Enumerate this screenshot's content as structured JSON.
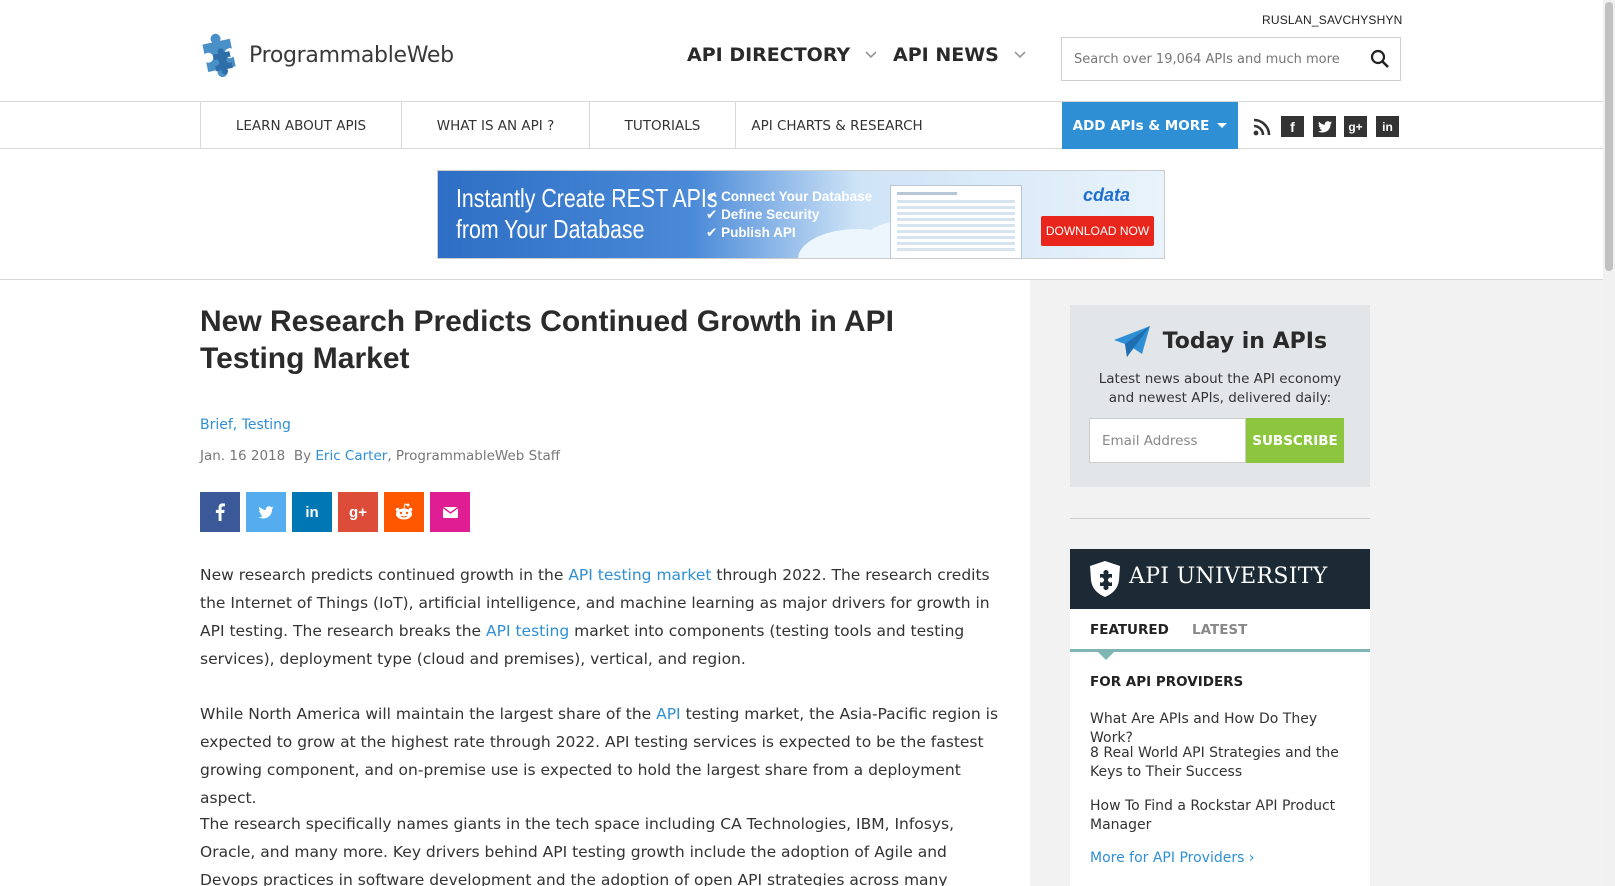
{
  "header": {
    "logo_text": "ProgrammableWeb",
    "username": "RUSLAN_SAVCHYSHYN",
    "nav": [
      {
        "label": "API DIRECTORY"
      },
      {
        "label": "API NEWS"
      }
    ],
    "search": {
      "placeholder": "Search over 19,064 APIs and much more"
    }
  },
  "subnav": {
    "items": [
      {
        "label": "LEARN ABOUT APIS"
      },
      {
        "label": "WHAT IS AN API ?"
      },
      {
        "label": "TUTORIALS"
      },
      {
        "label": "API CHARTS & RESEARCH"
      }
    ],
    "add_label": "ADD APIs & MORE",
    "social_icons": [
      "rss-icon",
      "facebook-icon",
      "twitter-icon",
      "google-plus-icon",
      "linkedin-icon"
    ]
  },
  "banner": {
    "headline_1": "Instantly Create REST APIs",
    "headline_2": "from Your Database",
    "bullets": [
      "Connect Your Database",
      "Define Security",
      "Publish API"
    ],
    "brand": "cdata",
    "cta": "DOWNLOAD NOW"
  },
  "article": {
    "title": "New Research Predicts Continued Growth in API Testing Market",
    "categories": [
      {
        "label": "Brief"
      },
      {
        "label": "Testing"
      }
    ],
    "date": "Jan. 16 2018",
    "by": "By",
    "author": "Eric Carter",
    "author_role": ", ProgrammableWeb Staff",
    "share_buttons": [
      {
        "icon": "facebook-icon",
        "color": "#3b5998"
      },
      {
        "icon": "twitter-icon",
        "color": "#55acee"
      },
      {
        "icon": "linkedin-icon",
        "color": "#0077b5"
      },
      {
        "icon": "google-plus-icon",
        "color": "#dd4b39"
      },
      {
        "icon": "reddit-icon",
        "color": "#ff5700"
      },
      {
        "icon": "email-icon",
        "color": "#e01e94"
      }
    ],
    "p1": {
      "a": "New research predicts continued growth in the ",
      "link1": "API testing market",
      "b": " through 2022. The research credits the Internet of Things (IoT), artificial intelligence, and machine learning as major drivers for growth in API testing. The research breaks the ",
      "link2": "API testing",
      "c": " market into components (testing tools and testing services), deployment type (cloud and premises), vertical, and region."
    },
    "p2": {
      "a": "While North America will maintain the largest share of the ",
      "link1": "API",
      "b": " testing market, the Asia-Pacific region is expected to grow at the highest rate through 2022. API testing services is expected to be the fastest growing component, and on-premise use is expected to hold the largest share from a deployment aspect."
    },
    "p3": "The research specifically names giants in the tech space including CA Technologies, IBM, Infosys, Oracle, and many more. Key drivers behind API testing growth include the adoption of Agile and Devops practices in software development and the adoption of open API strategies across many industries. The continued"
  },
  "sidebar": {
    "today": {
      "title": "Today in APIs",
      "subtitle": "Latest news about the API economy and newest APIs, delivered daily:",
      "email_placeholder": "Email Address",
      "subscribe": "SUBSCRIBE"
    },
    "university": {
      "title": "API UNIVERSITY",
      "tabs": [
        {
          "label": "FEATURED"
        },
        {
          "label": "LATEST"
        }
      ],
      "section": "FOR API PROVIDERS",
      "links": [
        {
          "label": "What Are APIs and How Do They Work?"
        },
        {
          "label": "8 Real World API Strategies and the Keys to Their Success"
        },
        {
          "label": "How To Find a Rockstar API Product Manager"
        }
      ],
      "more": "More for API Providers  ›"
    }
  }
}
